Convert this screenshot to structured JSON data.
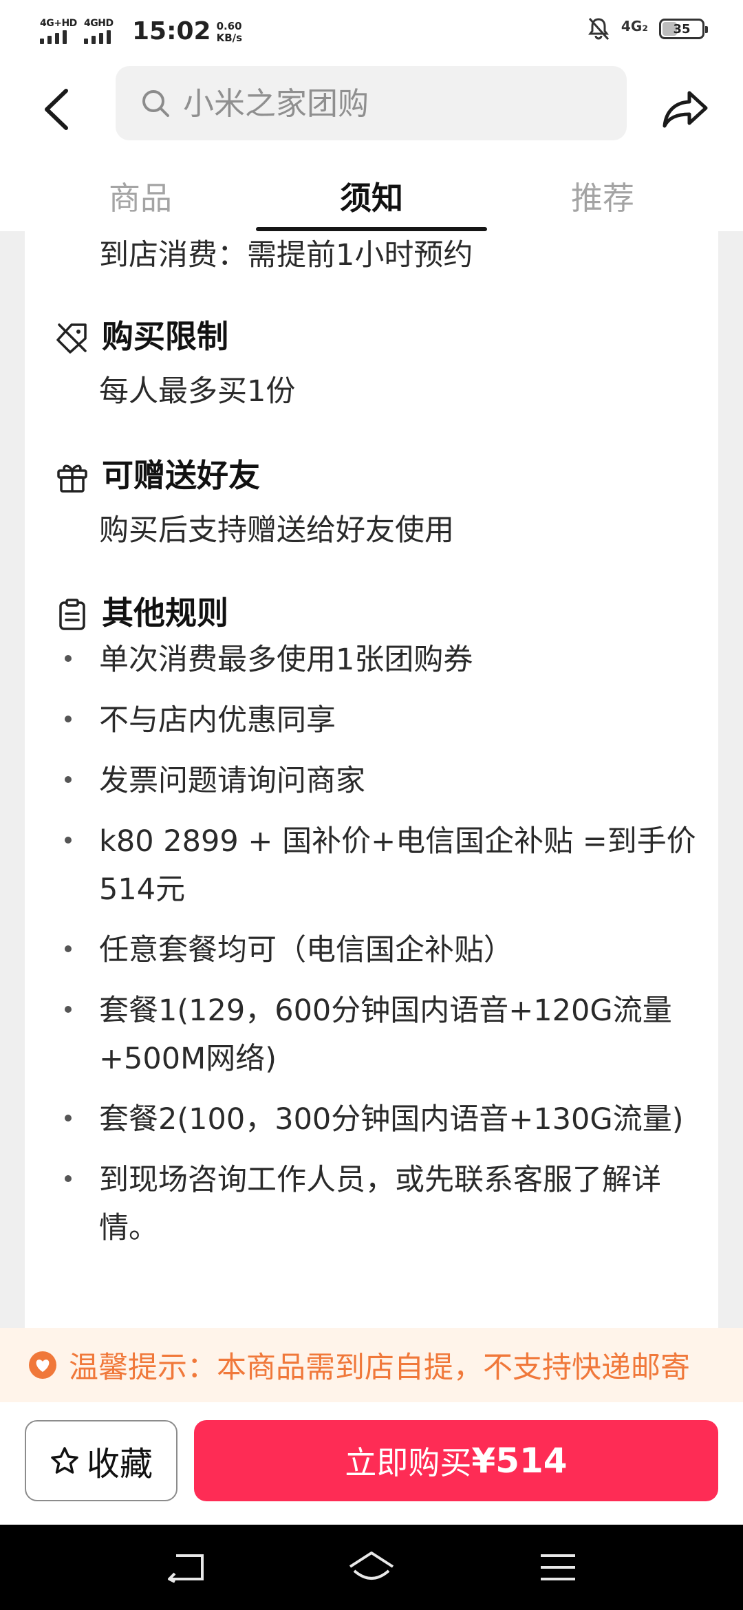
{
  "status_bar": {
    "signal_1_label": "4G+HD",
    "signal_2_label": "4GHD",
    "time": "15:02",
    "speed_value": "0.60",
    "speed_unit": "KB/s",
    "network_right": "4G₂",
    "battery": "35"
  },
  "header": {
    "search_placeholder": "小米之家团购",
    "tabs": [
      {
        "label": "商品",
        "active": false
      },
      {
        "label": "须知",
        "active": true
      },
      {
        "label": "推荐",
        "active": false
      }
    ]
  },
  "content": {
    "top_line": "到店消费：需提前1小时预约",
    "sections": [
      {
        "icon": "tag-slash-icon",
        "title": "购买限制",
        "text": "每人最多买1份"
      },
      {
        "icon": "gift-icon",
        "title": "可赠送好友",
        "text": "购买后支持赠送给好友使用"
      },
      {
        "icon": "clipboard-icon",
        "title": "其他规则"
      }
    ],
    "rules": [
      "单次消费最多使用1张团购券",
      "不与店内优惠同享",
      "发票问题请询问商家",
      "k80 2899 + 国补价+电信国企补贴 =到手价514元",
      "任意套餐均可（电信国企补贴）",
      "套餐1(129，600分钟国内语音+120G流量+500M网络)",
      "套餐2(100，300分钟国内语音+130G流量)",
      "到现场咨询工作人员，或先联系客服了解详情。"
    ]
  },
  "notice": {
    "text": "温馨提示：本商品需到店自提，不支持快递邮寄",
    "color": "#f0783a"
  },
  "actions": {
    "favorite_label": "收藏",
    "buy_label": "立即购买",
    "buy_price": "¥514",
    "buy_color": "#fe2c55"
  },
  "navbar": {
    "icons": [
      "back-nav-icon",
      "home-nav-icon",
      "menu-nav-icon"
    ]
  }
}
